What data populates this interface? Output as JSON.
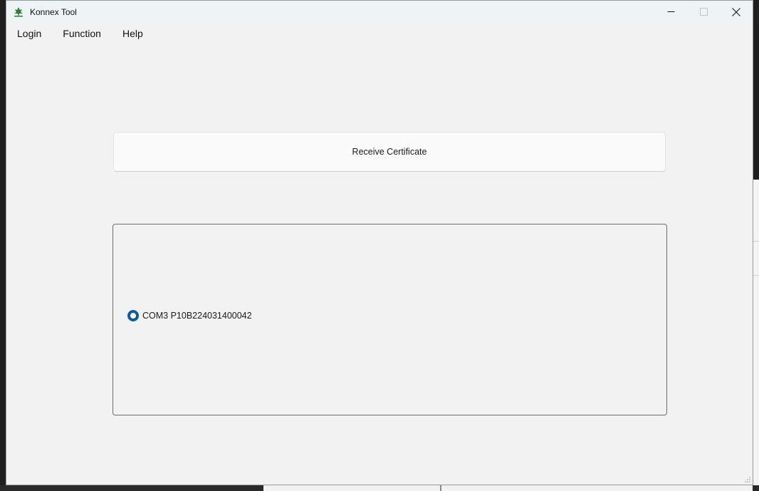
{
  "window": {
    "title": "Konnex Tool",
    "controls": {
      "minimize": "—",
      "maximize": "☐",
      "close": "✕"
    }
  },
  "menu": {
    "items": [
      "Login",
      "Function",
      "Help"
    ]
  },
  "main": {
    "receive_button_label": "Receive Certificate",
    "ports": [
      {
        "label": "COM3 P10B224031400042",
        "selected": true
      }
    ]
  },
  "colors": {
    "radio_accent": "#0b5aa6",
    "app_icon": "#2e7d32"
  }
}
